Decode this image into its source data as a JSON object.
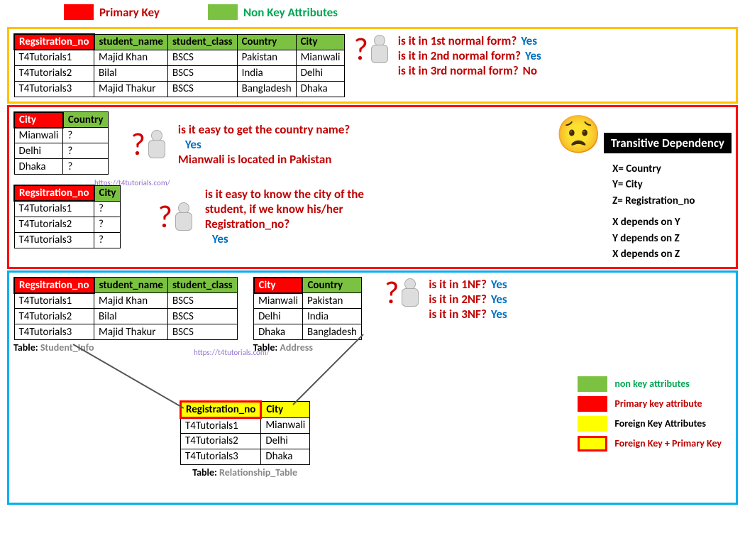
{
  "legend_top": {
    "pk": "Primary Key",
    "nk": "Non Key Attributes"
  },
  "box1": {
    "table": {
      "headers": [
        "Regsitration_no",
        "student_name",
        "student_class",
        "Country",
        "City"
      ],
      "rows": [
        [
          "T4Tutorials1",
          "Majid Khan",
          "BSCS",
          "Pakistan",
          "Mianwali"
        ],
        [
          "T4Tutorials2",
          "Bilal",
          "BSCS",
          "India",
          "Delhi"
        ],
        [
          "T4Tutorials3",
          "Majid Thakur",
          "BSCS",
          "Bangladesh",
          "Dhaka"
        ]
      ]
    },
    "q1": {
      "text": "is it in 1st normal form?",
      "ans": "Yes"
    },
    "q2": {
      "text": "is it in 2nd normal form?",
      "ans": "Yes"
    },
    "q3": {
      "text": "is it in 3rd normal form?",
      "ans": "No"
    }
  },
  "box2": {
    "tableA": {
      "headers": [
        "City",
        "Country"
      ],
      "rows": [
        [
          "Mianwali",
          "?"
        ],
        [
          "Delhi",
          "?"
        ],
        [
          "Dhaka",
          "?"
        ]
      ]
    },
    "qA": {
      "text": "is it easy to get the country name?",
      "ans": "Yes",
      "note": "Mianwali is located in Pakistan"
    },
    "tableB": {
      "headers": [
        "Regsitration_no",
        "City"
      ],
      "rows": [
        [
          "T4Tutorials1",
          "?"
        ],
        [
          "T4Tutorials2",
          "?"
        ],
        [
          "T4Tutorials3",
          "?"
        ]
      ]
    },
    "qB_line1": "is it easy to know the city of the",
    "qB_line2": "student, if we know his/her",
    "qB_line3": "Registration_no?",
    "qB_ans": "Yes",
    "td_title": "Transitive Dependency",
    "td_x": "X= Country",
    "td_y": "Y= City",
    "td_z": "Z= Registration_no",
    "td_d1": "X depends on Y",
    "td_d2": "Y depends on Z",
    "td_d3": "X depends on Z"
  },
  "box3": {
    "tableStudent": {
      "headers": [
        "Regsitration_no",
        "student_name",
        "student_class"
      ],
      "rows": [
        [
          "T4Tutorials1",
          "Majid Khan",
          "BSCS"
        ],
        [
          "T4Tutorials2",
          "Bilal",
          "BSCS"
        ],
        [
          "T4Tutorials3",
          "Majid Thakur",
          "BSCS"
        ]
      ],
      "caption_prefix": "Table: ",
      "caption": "Student_Info"
    },
    "tableAddress": {
      "headers": [
        "City",
        "Country"
      ],
      "rows": [
        [
          "Mianwali",
          "Pakistan"
        ],
        [
          "Delhi",
          "India"
        ],
        [
          "Dhaka",
          "Bangladesh"
        ]
      ],
      "caption_prefix": "Table: ",
      "caption": "Address"
    },
    "tableRel": {
      "headers": [
        "Registration_no",
        "City"
      ],
      "rows": [
        [
          "T4Tutorials1",
          "Mianwali"
        ],
        [
          "T4Tutorials2",
          "Delhi"
        ],
        [
          "T4Tutorials3",
          "Dhaka"
        ]
      ],
      "caption_prefix": "Table: ",
      "caption": "Relationship_Table"
    },
    "q1": {
      "text": "is it in 1NF?",
      "ans": "Yes"
    },
    "q2": {
      "text": "is it in 2NF?",
      "ans": "Yes"
    },
    "q3": {
      "text": "is it in 3NF?",
      "ans": "Yes"
    },
    "legend": {
      "nk": "non key attributes",
      "pk": "Primary key attribute",
      "fk": "Foreign Key Attributes",
      "fkpk": "Foreign Key + Primary Key"
    }
  },
  "watermark": "https://t4tutorials.com/"
}
